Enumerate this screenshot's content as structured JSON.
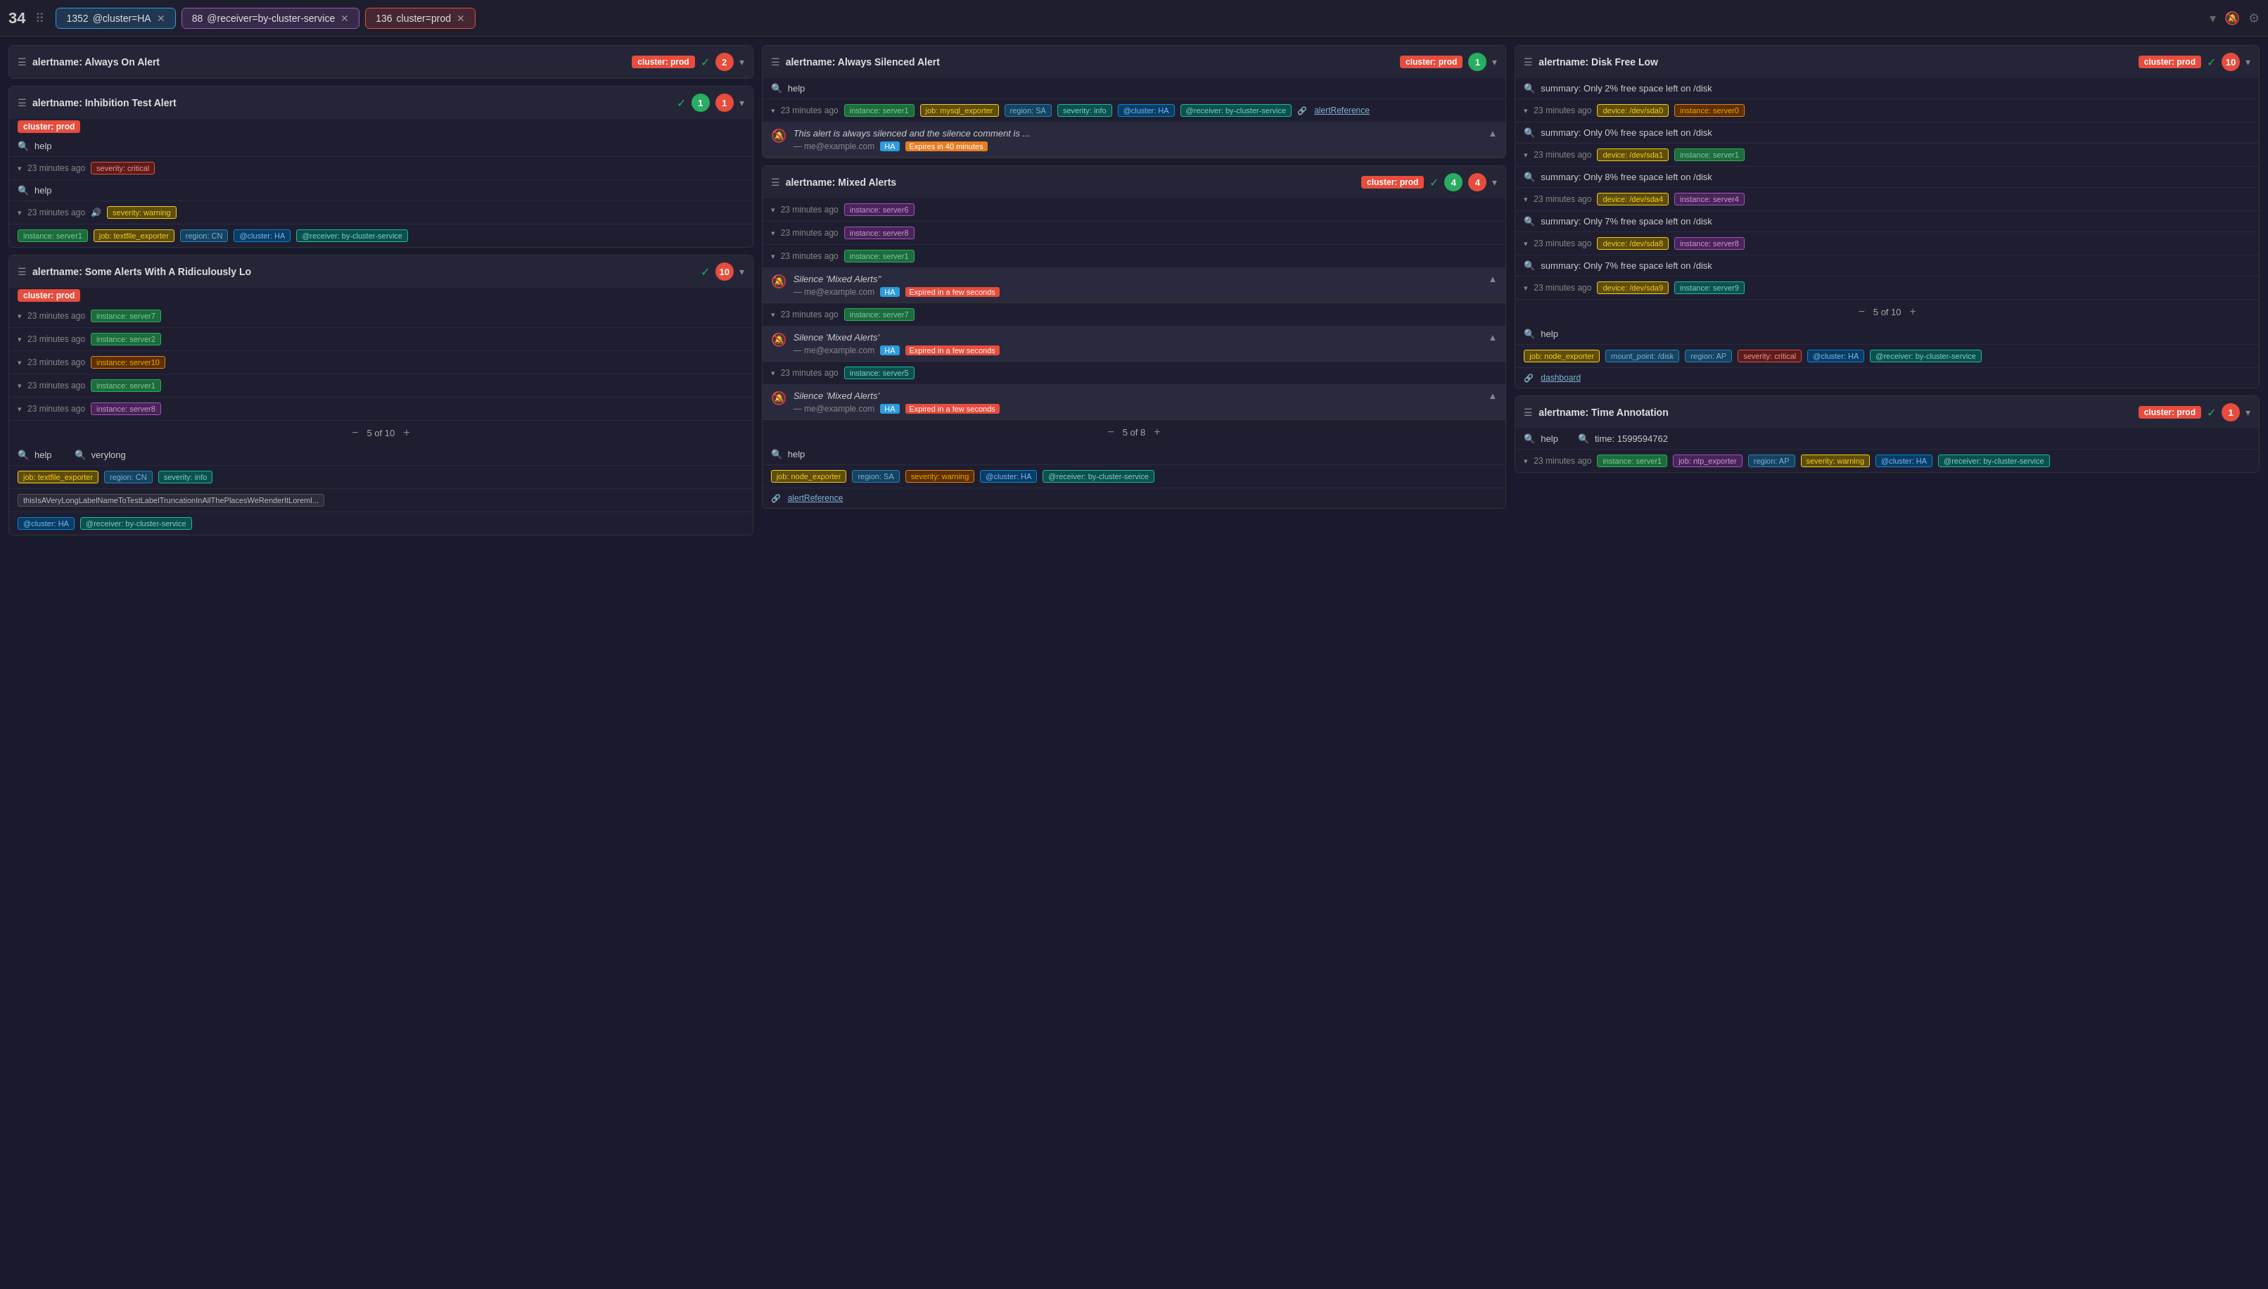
{
  "topbar": {
    "number": "34",
    "tabs": [
      {
        "count": "1352",
        "label": "@cluster=HA",
        "style": "tab-ha"
      },
      {
        "count": "88",
        "label": "@receiver=by-cluster-service",
        "style": "tab-receiver"
      },
      {
        "count": "136",
        "label": "cluster=prod",
        "style": "tab-prod"
      }
    ]
  },
  "columns": [
    {
      "groups": [
        {
          "id": "inhibition-test",
          "title": "alertname: Inhibition Test Alert",
          "cluster": "cluster: prod",
          "hasCheck": true,
          "counts": [
            {
              "val": "1",
              "color": "badge-green"
            },
            {
              "val": "1",
              "color": "badge-red"
            }
          ],
          "sections": [
            {
              "type": "search",
              "label": "help"
            },
            {
              "type": "alert",
              "time": "23 minutes ago",
              "tags": [
                {
                  "text": "severity: critical",
                  "cls": "tag-red"
                }
              ]
            },
            {
              "type": "search",
              "label": "help"
            },
            {
              "type": "alert",
              "time": "23 minutes ago",
              "volumeIcon": true,
              "tags": [
                {
                  "text": "severity: warning",
                  "cls": "tag-yellow"
                }
              ]
            },
            {
              "type": "tags-only",
              "tags": [
                {
                  "text": "instance: server1",
                  "cls": "tag-green"
                },
                {
                  "text": "job: textfile_exporter",
                  "cls": "tag-yellow"
                },
                {
                  "text": "region: CN",
                  "cls": "tag-blue"
                },
                {
                  "text": "@cluster: HA",
                  "cls": "tag-cyan"
                },
                {
                  "text": "@receiver: by-cluster-service",
                  "cls": "tag-teal"
                }
              ]
            }
          ]
        },
        {
          "id": "some-alerts",
          "title": "alertname: Some Alerts With A Ridiculously Lo",
          "cluster": "cluster: prod",
          "hasCheck": true,
          "counts": [
            {
              "val": "10",
              "color": "badge-red"
            }
          ],
          "sections": [
            {
              "type": "alert",
              "time": "23 minutes ago",
              "tags": [
                {
                  "text": "instance: server7",
                  "cls": "tag-green"
                }
              ]
            },
            {
              "type": "alert",
              "time": "23 minutes ago",
              "tags": [
                {
                  "text": "instance: server2",
                  "cls": "tag-green"
                }
              ]
            },
            {
              "type": "alert",
              "time": "23 minutes ago",
              "tags": [
                {
                  "text": "instance: server10",
                  "cls": "tag-orange"
                }
              ]
            },
            {
              "type": "alert",
              "time": "23 minutes ago",
              "tags": [
                {
                  "text": "instance: server1",
                  "cls": "tag-green"
                }
              ]
            },
            {
              "type": "alert",
              "time": "23 minutes ago",
              "tags": [
                {
                  "text": "instance: server8",
                  "cls": "tag-purple"
                }
              ]
            },
            {
              "type": "pagination",
              "current": "5",
              "total": "10"
            },
            {
              "type": "search",
              "label": "help"
            },
            {
              "type": "search",
              "label": "verylong"
            },
            {
              "type": "tags-only",
              "tags": [
                {
                  "text": "job: textfile_exporter",
                  "cls": "tag-yellow"
                },
                {
                  "text": "region: CN",
                  "cls": "tag-blue"
                },
                {
                  "text": "severity: info",
                  "cls": "tag-teal"
                }
              ]
            },
            {
              "type": "long-label",
              "text": "thisIsAVeryLongLabelNameToTestLabelTruncationInAllThePlacesWeRenderItLoreml..."
            },
            {
              "type": "tags-only",
              "tags": [
                {
                  "text": "@cluster: HA",
                  "cls": "tag-cyan"
                },
                {
                  "text": "@receiver: by-cluster-service",
                  "cls": "tag-teal"
                }
              ]
            }
          ]
        }
      ]
    },
    {
      "groups": [
        {
          "id": "always-on-alert-left",
          "title": "alertname: Always On Alert",
          "cluster": "cluster: prod",
          "hasCheck": true,
          "counts": [
            {
              "val": "2",
              "color": "badge-red"
            }
          ],
          "sections": []
        },
        {
          "id": "always-silenced",
          "title": "alertname: Always Silenced Alert",
          "cluster": "cluster: prod",
          "hasCheck": false,
          "counts": [
            {
              "val": "1",
              "color": "badge-green"
            }
          ],
          "sections": [
            {
              "type": "search",
              "label": "help"
            },
            {
              "type": "alert",
              "time": "23 minutes ago",
              "tags": [
                {
                  "text": "instance: server1",
                  "cls": "tag-green"
                },
                {
                  "text": "job: mysql_exporter",
                  "cls": "tag-yellow"
                },
                {
                  "text": "region: SA",
                  "cls": "tag-blue"
                },
                {
                  "text": "severity: info",
                  "cls": "tag-teal"
                },
                {
                  "text": "@cluster: HA",
                  "cls": "tag-cyan"
                },
                {
                  "text": "@receiver: by-cluster-service",
                  "cls": "tag-teal"
                }
              ],
              "link": "alertReference"
            },
            {
              "type": "silence",
              "text": "This alert is always silenced and the silence comment is ...",
              "user": "— me@example.com",
              "ha": "HA",
              "expires": "Expires in 40 minutes",
              "expiresClass": "expires-badge-yellow"
            }
          ]
        },
        {
          "id": "mixed-alerts",
          "title": "alertname: Mixed Alerts",
          "cluster": "cluster: prod",
          "hasCheck": true,
          "counts": [
            {
              "val": "4",
              "color": "badge-green"
            },
            {
              "val": "4",
              "color": "badge-red"
            }
          ],
          "sections": [
            {
              "type": "alert",
              "time": "23 minutes ago",
              "tags": [
                {
                  "text": "instance: server6",
                  "cls": "tag-purple"
                }
              ]
            },
            {
              "type": "alert",
              "time": "23 minutes ago",
              "tags": [
                {
                  "text": "instance: server8",
                  "cls": "tag-purple"
                }
              ]
            },
            {
              "type": "alert",
              "time": "23 minutes ago",
              "tags": [
                {
                  "text": "instance: server1",
                  "cls": "tag-green"
                }
              ]
            },
            {
              "type": "silence",
              "text": "Silence 'Mixed Alerts''",
              "user": "— me@example.com",
              "ha": "HA",
              "expires": "Expired in a few seconds",
              "expiresClass": "expires-badge-red"
            },
            {
              "type": "alert",
              "time": "23 minutes ago",
              "tags": [
                {
                  "text": "instance: server7",
                  "cls": "tag-green"
                }
              ]
            },
            {
              "type": "silence",
              "text": "Silence 'Mixed Alerts'",
              "user": "— me@example.com",
              "ha": "HA",
              "expires": "Expired in a few seconds",
              "expiresClass": "expires-badge-red"
            },
            {
              "type": "alert",
              "time": "23 minutes ago",
              "tags": [
                {
                  "text": "instance: server5",
                  "cls": "tag-teal"
                }
              ]
            },
            {
              "type": "silence",
              "text": "Silence 'Mixed Alerts'",
              "user": "— me@example.com",
              "ha": "HA",
              "expires": "Expired in a few seconds",
              "expiresClass": "expires-badge-red"
            },
            {
              "type": "pagination",
              "current": "5",
              "total": "8"
            },
            {
              "type": "search",
              "label": "help"
            },
            {
              "type": "tags-only",
              "tags": [
                {
                  "text": "job: node_exporter",
                  "cls": "tag-yellow"
                },
                {
                  "text": "region: SA",
                  "cls": "tag-blue"
                },
                {
                  "text": "severity: warning",
                  "cls": "tag-orange"
                },
                {
                  "text": "@cluster: HA",
                  "cls": "tag-cyan"
                },
                {
                  "text": "@receiver: by-cluster-service",
                  "cls": "tag-teal"
                }
              ]
            },
            {
              "type": "link-row",
              "link": "alertReference"
            }
          ]
        }
      ]
    },
    {
      "groups": [
        {
          "id": "always-on-top-right",
          "title": "alertname: Always On Alert",
          "cluster": "cluster: prod",
          "hasCheck": true,
          "counts": [
            {
              "val": "10",
              "color": "badge-red"
            }
          ],
          "sections": [
            {
              "type": "text-row",
              "text": "summary: Only 2% free space left on /disk"
            },
            {
              "type": "alert",
              "time": "23 minutes ago",
              "tags": [
                {
                  "text": "device: /dev/sda0",
                  "cls": "tag-yellow"
                },
                {
                  "text": "instance: server0",
                  "cls": "tag-orange"
                }
              ]
            },
            {
              "type": "text-row",
              "text": "summary: Only 0% free space left on /disk"
            },
            {
              "type": "alert",
              "time": "23 minutes ago",
              "tags": [
                {
                  "text": "device: /dev/sda1",
                  "cls": "tag-yellow"
                },
                {
                  "text": "instance: server1",
                  "cls": "tag-green"
                }
              ]
            },
            {
              "type": "text-row",
              "text": "summary: Only 8% free space left on /disk"
            },
            {
              "type": "alert",
              "time": "23 minutes ago",
              "tags": [
                {
                  "text": "device: /dev/sda4",
                  "cls": "tag-yellow"
                },
                {
                  "text": "instance: server4",
                  "cls": "tag-purple"
                }
              ]
            },
            {
              "type": "text-row",
              "text": "summary: Only 7% free space left on /disk"
            },
            {
              "type": "alert",
              "time": "23 minutes ago",
              "tags": [
                {
                  "text": "device: /dev/sda8",
                  "cls": "tag-yellow"
                },
                {
                  "text": "instance: server8",
                  "cls": "tag-purple"
                }
              ]
            },
            {
              "type": "text-row",
              "text": "summary: Only 7% free space left on /disk"
            },
            {
              "type": "alert",
              "time": "23 minutes ago",
              "tags": [
                {
                  "text": "device: /dev/sda9",
                  "cls": "tag-yellow"
                },
                {
                  "text": "instance: server9",
                  "cls": "tag-teal"
                }
              ]
            },
            {
              "type": "pagination",
              "current": "5",
              "total": "10"
            },
            {
              "type": "search",
              "label": "help"
            },
            {
              "type": "tags-only",
              "tags": [
                {
                  "text": "job: node_exporter",
                  "cls": "tag-yellow"
                },
                {
                  "text": "mount_point: /disk",
                  "cls": "tag-blue"
                },
                {
                  "text": "region: AP",
                  "cls": "tag-blue"
                },
                {
                  "text": "severity: critical",
                  "cls": "tag-red"
                },
                {
                  "text": "@cluster: HA",
                  "cls": "tag-cyan"
                },
                {
                  "text": "@receiver: by-cluster-service",
                  "cls": "tag-teal"
                }
              ]
            },
            {
              "type": "link-row",
              "link": "dashboard"
            }
          ]
        },
        {
          "id": "disk-free-low",
          "title": "alertname: Disk Free Low",
          "cluster": "cluster: prod",
          "hasCheck": true,
          "counts": [],
          "headerTitle": "alertname: Disk Free Low"
        },
        {
          "id": "time-annotation",
          "title": "alertname: Time Annotation",
          "cluster": "cluster: prod",
          "hasCheck": true,
          "counts": [
            {
              "val": "1",
              "color": "badge-red"
            }
          ],
          "sections": [
            {
              "type": "search-double",
              "label1": "help",
              "label2": "time: 1599594762"
            },
            {
              "type": "alert",
              "time": "23 minutes ago",
              "tags": [
                {
                  "text": "instance: server1",
                  "cls": "tag-green"
                },
                {
                  "text": "job: ntp_exporter",
                  "cls": "tag-purple"
                },
                {
                  "text": "region: AP",
                  "cls": "tag-blue"
                },
                {
                  "text": "severity: warning",
                  "cls": "tag-yellow"
                },
                {
                  "text": "@cluster: HA",
                  "cls": "tag-cyan"
                },
                {
                  "text": "@receiver: by-cluster-service",
                  "cls": "tag-teal"
                }
              ]
            }
          ]
        }
      ]
    }
  ]
}
